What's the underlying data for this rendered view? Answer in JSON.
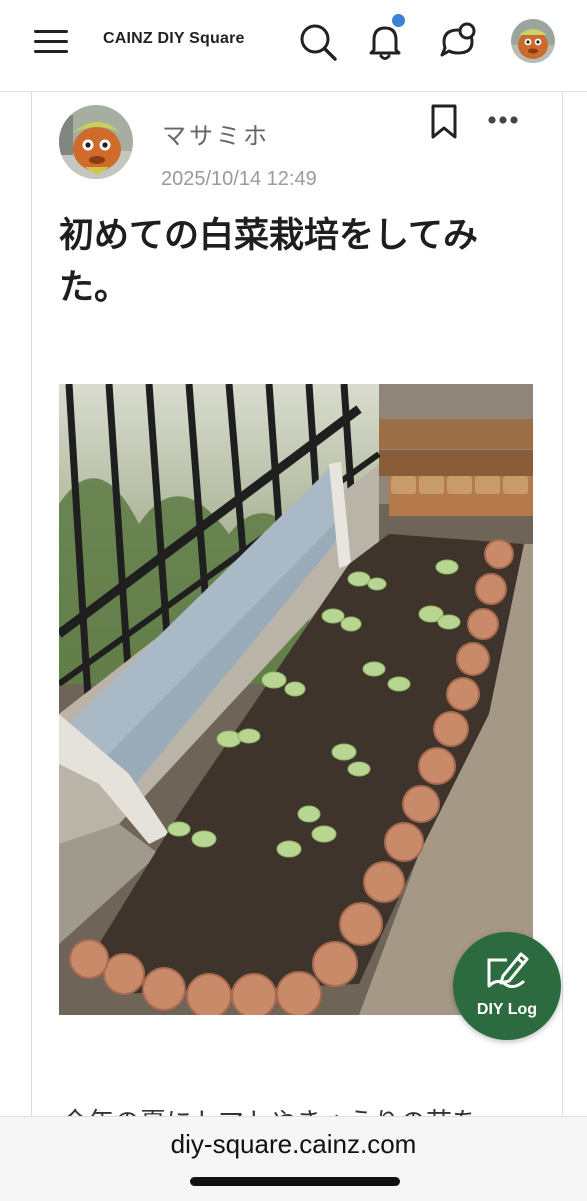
{
  "header": {
    "brand": "CAINZ DIY Square",
    "notification_dot_color": "#3b82d6",
    "icons": [
      "menu-icon",
      "search-icon",
      "bell-icon",
      "chat-icon"
    ]
  },
  "post": {
    "author": "マサミホ",
    "date": "2025/10/14 12:49",
    "title": "初めての白菜栽培をしてみた。",
    "image_alt": "Photo of a garden bed with young napa cabbage seedlings bordered by brick edging",
    "body_preview": "今年の夏にトマトやきゅうりの苗を"
  },
  "fab": {
    "label": "DIY Log",
    "color": "#2c6a3f"
  },
  "browser": {
    "url": "diy-square.cainz.com"
  }
}
